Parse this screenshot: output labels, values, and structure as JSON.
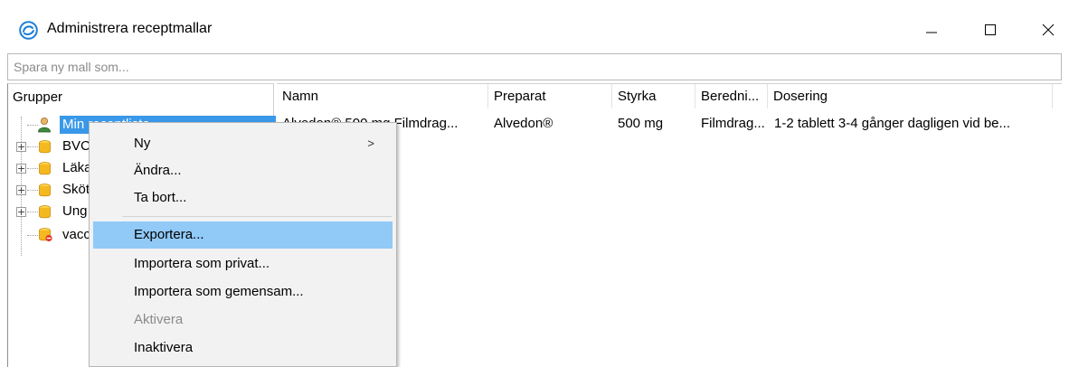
{
  "window": {
    "title": "Administrera receptmallar",
    "controls": {
      "minimize": "—",
      "maximize": "☐",
      "close": "✕"
    }
  },
  "name_input": {
    "placeholder": "Spara ny mall som...",
    "value": ""
  },
  "tree": {
    "header": "Grupper",
    "items": [
      {
        "label": "Min receptlista",
        "icon": "user-icon",
        "expandable": false,
        "selected": true
      },
      {
        "label": "BVC",
        "icon": "database-icon",
        "expandable": true
      },
      {
        "label": "Läka",
        "icon": "database-icon",
        "expandable": true
      },
      {
        "label": "Sköt",
        "icon": "database-icon",
        "expandable": true
      },
      {
        "label": "Ung",
        "icon": "database-icon",
        "expandable": true
      },
      {
        "label": "vacc",
        "icon": "database-warning-icon",
        "expandable": false
      }
    ]
  },
  "list": {
    "columns": [
      "Namn",
      "Preparat",
      "Styrka",
      "Beredni...",
      "Dosering"
    ],
    "rows": [
      [
        "Alvedon® 500 mg Filmdrag...",
        "Alvedon®",
        "500 mg",
        "Filmdrag...",
        "1-2 tablett 3-4 gånger dagligen vid be..."
      ]
    ]
  },
  "context_menu": {
    "items": [
      {
        "label": "Ny",
        "submenu_arrow": ">"
      },
      {
        "label": "Ändra..."
      },
      {
        "label": "Ta bort..."
      },
      {
        "label": "Exportera...",
        "highlighted": true
      },
      {
        "label": "Importera som privat..."
      },
      {
        "label": "Importera som gemensam..."
      },
      {
        "label": "Aktivera",
        "disabled": true
      },
      {
        "label": "Inaktivera"
      }
    ]
  },
  "colors": {
    "selection": "#3a98e9",
    "menu_highlight": "#91c9f7",
    "menu_bg": "#f2f2f2",
    "app_icon": "#1c7fd6",
    "database_icon": "#f5b920"
  }
}
